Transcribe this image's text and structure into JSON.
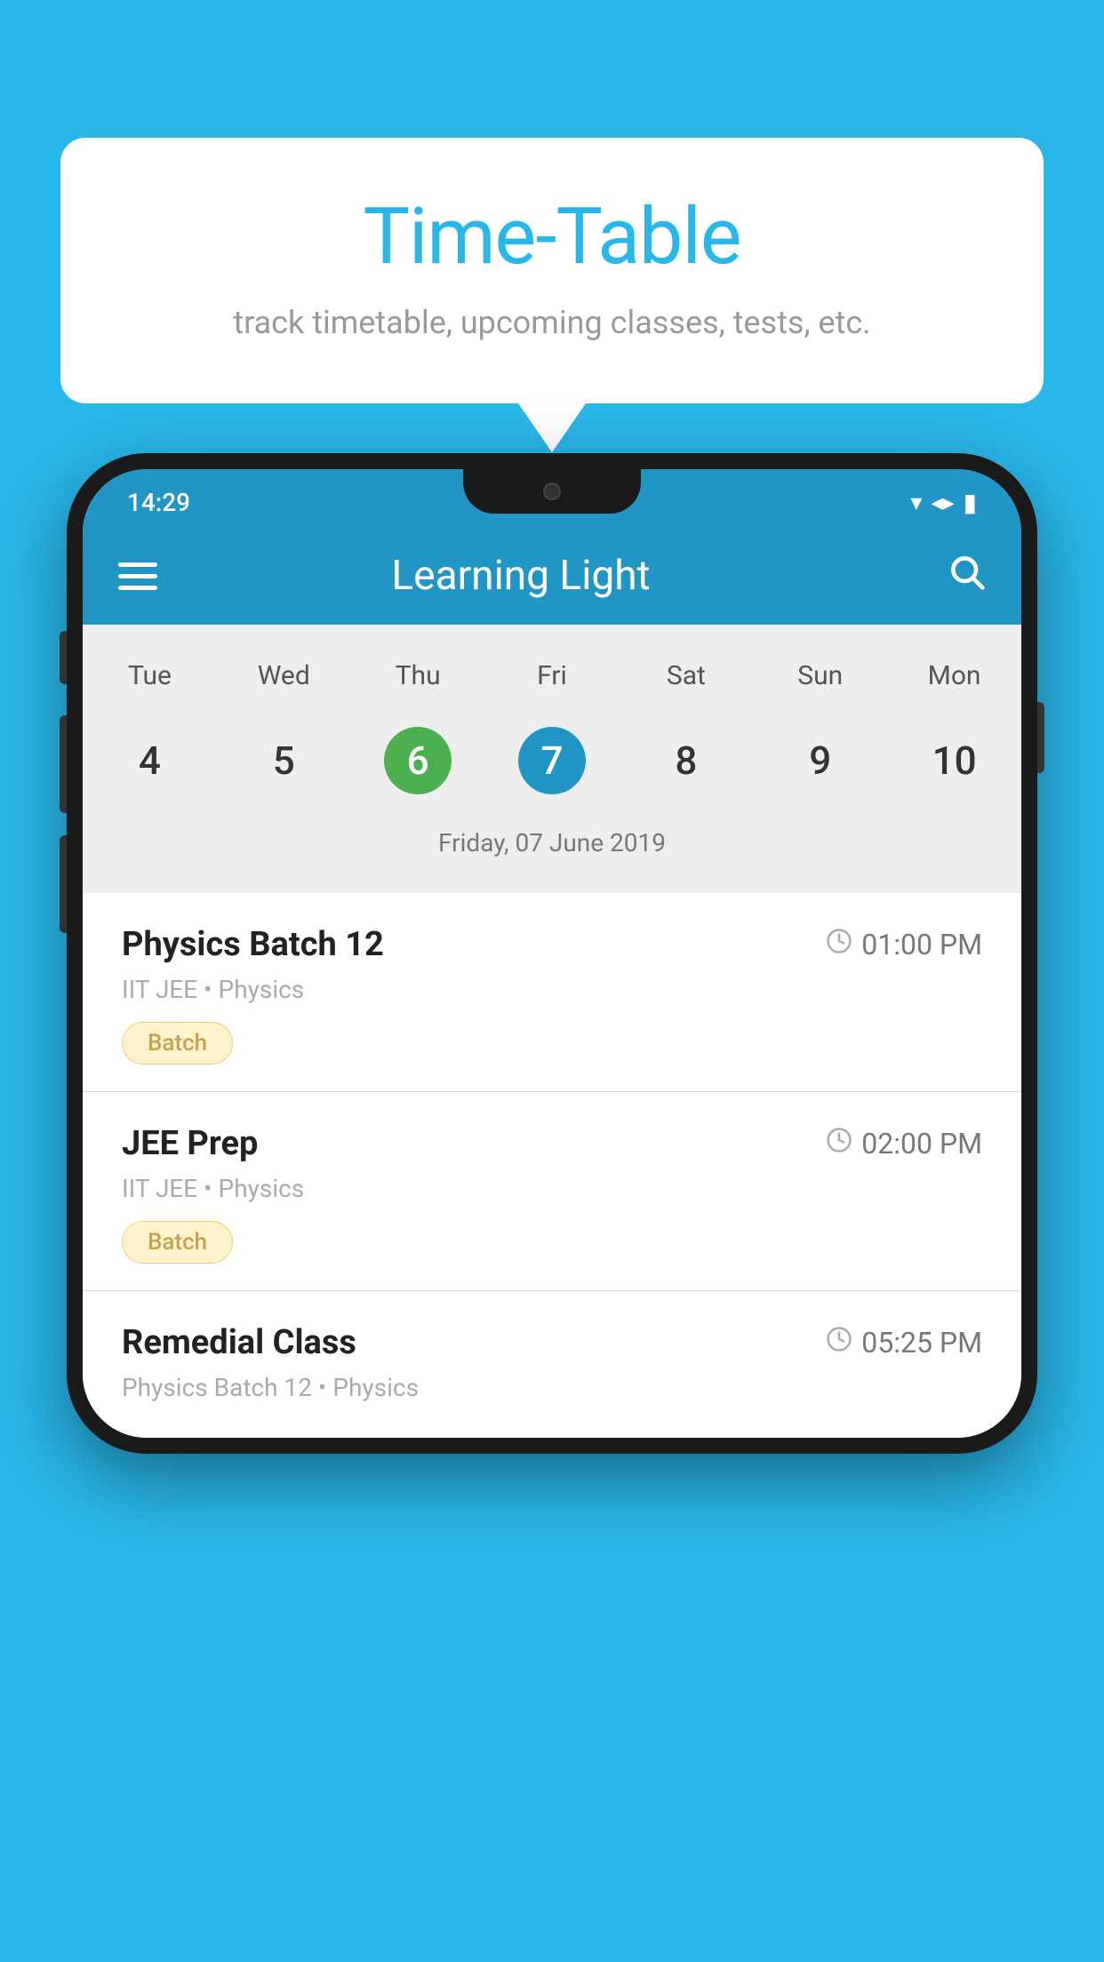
{
  "background_color": "#29b6e8",
  "speech_bubble": {
    "title": "Time-Table",
    "subtitle": "track timetable, upcoming classes, tests, etc."
  },
  "phone": {
    "status_bar": {
      "time": "14:29",
      "wifi": "▾",
      "signal": "▴",
      "battery": "▮"
    },
    "app_bar": {
      "title": "Learning Light",
      "menu_icon": "menu",
      "search_icon": "search"
    },
    "calendar": {
      "days": [
        "Tue",
        "Wed",
        "Thu",
        "Fri",
        "Sat",
        "Sun",
        "Mon"
      ],
      "dates": [
        "4",
        "5",
        "6",
        "7",
        "8",
        "9",
        "10"
      ],
      "today_index": 2,
      "selected_index": 3,
      "selected_label": "Friday, 07 June 2019"
    },
    "schedule": [
      {
        "title": "Physics Batch 12",
        "time": "01:00 PM",
        "subtitle": "IIT JEE • Physics",
        "tag": "Batch"
      },
      {
        "title": "JEE Prep",
        "time": "02:00 PM",
        "subtitle": "IIT JEE • Physics",
        "tag": "Batch"
      },
      {
        "title": "Remedial Class",
        "time": "05:25 PM",
        "subtitle": "Physics Batch 12 • Physics",
        "tag": null
      }
    ]
  }
}
